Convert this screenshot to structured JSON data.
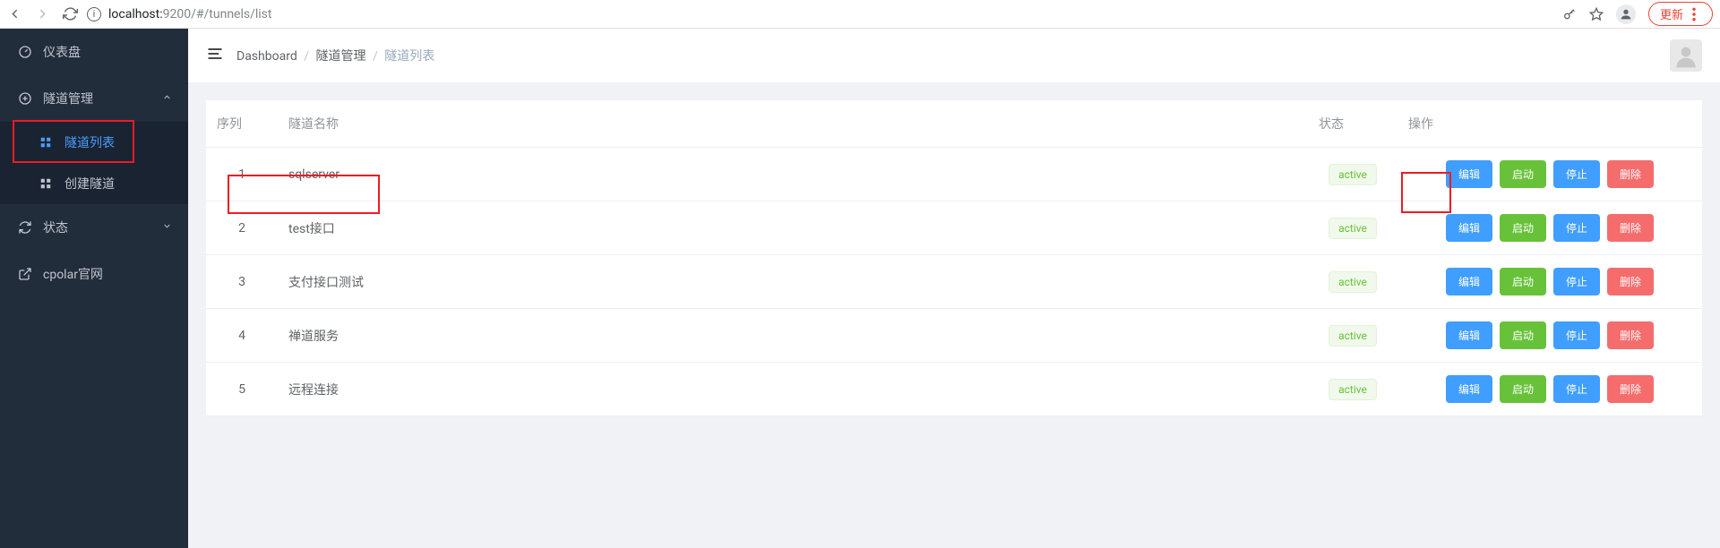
{
  "browser": {
    "url_host": "localhost:",
    "url_port_path": "9200/#/tunnels/list",
    "update_label": "更新"
  },
  "sidebar": {
    "items": [
      {
        "label": "仪表盘",
        "icon": "gauge",
        "hasChildren": false
      },
      {
        "label": "隧道管理",
        "icon": "plus-circle",
        "hasChildren": true,
        "expanded": true,
        "children": [
          {
            "label": "隧道列表",
            "active": true
          },
          {
            "label": "创建隧道",
            "active": false
          }
        ]
      },
      {
        "label": "状态",
        "icon": "refresh",
        "hasChildren": true,
        "expanded": false
      },
      {
        "label": "cpolar官网",
        "icon": "external",
        "hasChildren": false
      }
    ]
  },
  "breadcrumb": {
    "root": "Dashboard",
    "mid": "隧道管理",
    "last": "隧道列表"
  },
  "table": {
    "headers": {
      "seq": "序列",
      "name": "隧道名称",
      "status": "状态",
      "ops": "操作"
    },
    "status_label": "active",
    "op_labels": {
      "edit": "编辑",
      "start": "启动",
      "stop": "停止",
      "del": "删除"
    },
    "rows": [
      {
        "seq": "1",
        "name": "sqlserver"
      },
      {
        "seq": "2",
        "name": "test接口"
      },
      {
        "seq": "3",
        "name": "支付接口测试"
      },
      {
        "seq": "4",
        "name": "禅道服务"
      },
      {
        "seq": "5",
        "name": "远程连接"
      }
    ]
  }
}
